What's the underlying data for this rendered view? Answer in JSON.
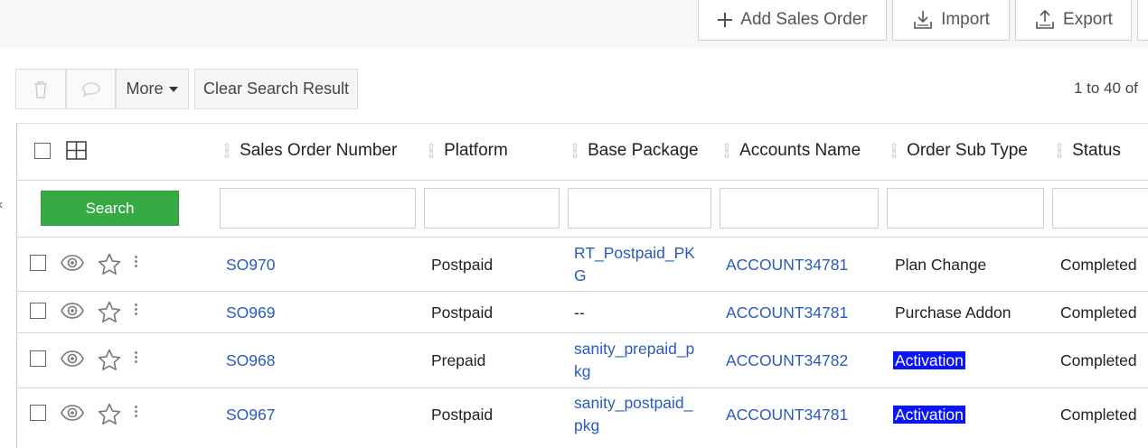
{
  "toolbar": {
    "add_label": "Add Sales Order",
    "import_label": "Import",
    "export_label": "Export"
  },
  "actions": {
    "more_label": "More",
    "clear_label": "Clear Search Result",
    "page_info": "1 to 40  of"
  },
  "table": {
    "columns": [
      "Sales Order Number",
      "Platform",
      "Base Package",
      "Accounts Name",
      "Order Sub Type",
      "Status"
    ],
    "search_label": "Search",
    "rows": [
      {
        "number": "SO970",
        "platform": "Postpaid",
        "pkg1": "RT_Postpaid_PK",
        "pkg2": "G",
        "account": "ACCOUNT34781",
        "subtype": "Plan Change",
        "status": "Completed"
      },
      {
        "number": "SO969",
        "platform": "Postpaid",
        "pkg1": "--",
        "pkg2": "",
        "account": "ACCOUNT34781",
        "subtype": "Purchase Addon",
        "status": "Completed"
      },
      {
        "number": "SO968",
        "platform": "Prepaid",
        "pkg1": "sanity_prepaid_p",
        "pkg2": "kg",
        "account": "ACCOUNT34782",
        "subtype": "Activation",
        "status": "Completed"
      },
      {
        "number": "SO967",
        "platform": "Postpaid",
        "pkg1": "sanity_postpaid_",
        "pkg2": "pkg",
        "account": "ACCOUNT34781",
        "subtype": "Activation",
        "status": "Completed"
      }
    ]
  },
  "colors": {
    "link": "#2a5bbf",
    "search_button": "#37aa45",
    "highlight": "#0a14ff"
  },
  "icons": [
    "plus-icon",
    "import-icon",
    "export-icon",
    "trash-icon",
    "comment-icon",
    "caret-down-icon",
    "grid-icon",
    "sort-icon",
    "eye-icon",
    "star-icon",
    "kebab-icon",
    "chevron-left-icon"
  ]
}
